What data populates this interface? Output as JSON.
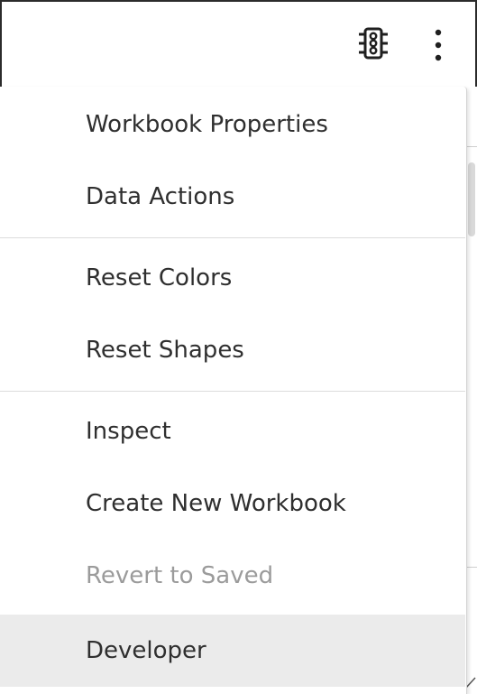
{
  "toolbar": {
    "icons": [
      "traffic-light-icon",
      "more-vertical-icon"
    ]
  },
  "menu": {
    "groups": [
      [
        {
          "label": "Workbook Properties",
          "state": "normal"
        },
        {
          "label": "Data Actions",
          "state": "normal"
        }
      ],
      [
        {
          "label": "Reset Colors",
          "state": "normal"
        },
        {
          "label": "Reset Shapes",
          "state": "normal"
        }
      ],
      [
        {
          "label": "Inspect",
          "state": "normal"
        },
        {
          "label": "Create New Workbook",
          "state": "normal"
        },
        {
          "label": "Revert to Saved",
          "state": "disabled"
        },
        {
          "label": "Developer",
          "state": "hovered"
        }
      ]
    ]
  },
  "colors": {
    "text": "#2f2f2f",
    "disabled_text": "#9b9b9b",
    "hover_background": "#ebebeb",
    "separator": "#dcdcdc"
  }
}
